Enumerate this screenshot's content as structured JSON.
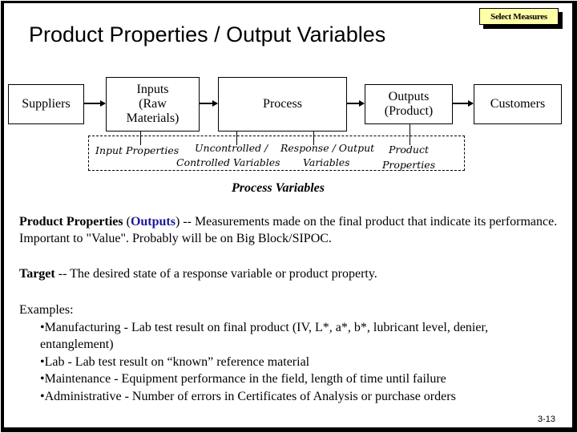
{
  "title": "Product Properties / Output Variables",
  "select_button": {
    "label": "Select Measures",
    "bg_color": "#ffffa8"
  },
  "diagram": {
    "boxes": [
      {
        "id": "suppliers",
        "label": "Suppliers"
      },
      {
        "id": "inputs",
        "label": "Inputs\n(Raw\nMaterials)"
      },
      {
        "id": "process",
        "label": "Process"
      },
      {
        "id": "outputs",
        "label": "Outputs\n(Product)"
      },
      {
        "id": "customers",
        "label": "Customers"
      }
    ],
    "variable_labels": {
      "input_properties": "Input Properties",
      "uncontrolled_1": "Uncontrolled /",
      "uncontrolled_2": "Controlled Variables",
      "response_1": "Response / Output",
      "response_2": "Variables",
      "product_1": "Product",
      "product_2": "Properties"
    },
    "group_label": "Process Variables"
  },
  "definitions": {
    "product_properties": {
      "term": "Product Properties",
      "open_paren": " (",
      "highlight": "Outputs",
      "close_paren": ")",
      "text": " -- Measurements made on the final product that indicate its performance. Important to \"Value\". Probably will be on Big Block/SIPOC.",
      "highlight_color": "#1a1a99"
    },
    "target": {
      "term": "Target",
      "text": " -- The desired state of a response variable or product property."
    }
  },
  "examples": {
    "heading": "Examples:",
    "items": [
      "•Manufacturing - Lab test result on final product (IV, L*, a*, b*, lubricant level, denier,",
      "entanglement)",
      "•Lab - Lab test result on “known” reference material",
      "•Maintenance - Equipment performance in the field, length of time until failure",
      "•Administrative - Number of errors in Certificates of Analysis or purchase orders"
    ]
  },
  "page_number": "3-13"
}
